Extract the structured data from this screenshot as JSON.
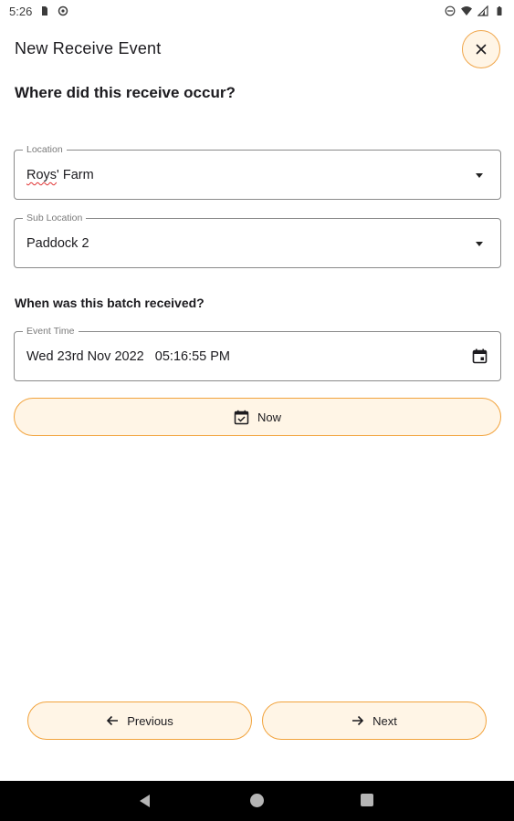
{
  "status_bar": {
    "time": "5:26",
    "icons": [
      "sim-card-icon",
      "sync-icon",
      "do-not-disturb-icon",
      "wifi-icon",
      "signal-icon",
      "battery-icon"
    ]
  },
  "header": {
    "title": "New Receive Event",
    "close_icon": "close-icon"
  },
  "location_section": {
    "question": "Where did this receive occur?",
    "location": {
      "label": "Location",
      "value_misspelled": "Roys",
      "value_rest": "' Farm"
    },
    "sub_location": {
      "label": "Sub Location",
      "value": "Paddock 2"
    }
  },
  "time_section": {
    "question": "When was this batch received?",
    "event_time": {
      "label": "Event Time",
      "value": "Wed 23rd Nov 2022   05:16:55 PM"
    },
    "now_button": {
      "label": "Now",
      "icon": "calendar-check-icon"
    }
  },
  "footer": {
    "previous_label": "Previous",
    "next_label": "Next"
  },
  "colors": {
    "accent_border": "#f2a33c",
    "accent_fill": "#fff5e6"
  }
}
